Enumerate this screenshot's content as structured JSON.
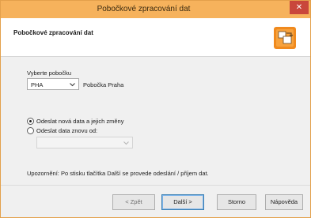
{
  "window": {
    "title": "Pobočkové zpracování dat",
    "close_glyph": "✕"
  },
  "header": {
    "title": "Pobočkové zpracování dat",
    "icon": "wizard-icon"
  },
  "branch": {
    "label": "Vyberte pobočku",
    "code": "PHA",
    "name": "Pobočka Praha"
  },
  "options": {
    "send_new": "Odeslat nová data a jejich změny",
    "send_again": "Odeslat data znovu od:",
    "send_again_value": ""
  },
  "notice": "Upozornění: Po stisku tlačítka Další se provede odeslání / příjem dat.",
  "buttons": {
    "back": "< Zpět",
    "next": "Další >",
    "cancel": "Storno",
    "help": "Nápověda"
  },
  "colors": {
    "titlebar": "#f6b25c",
    "close": "#c9473b",
    "icon_orange": "#f08a1e"
  }
}
